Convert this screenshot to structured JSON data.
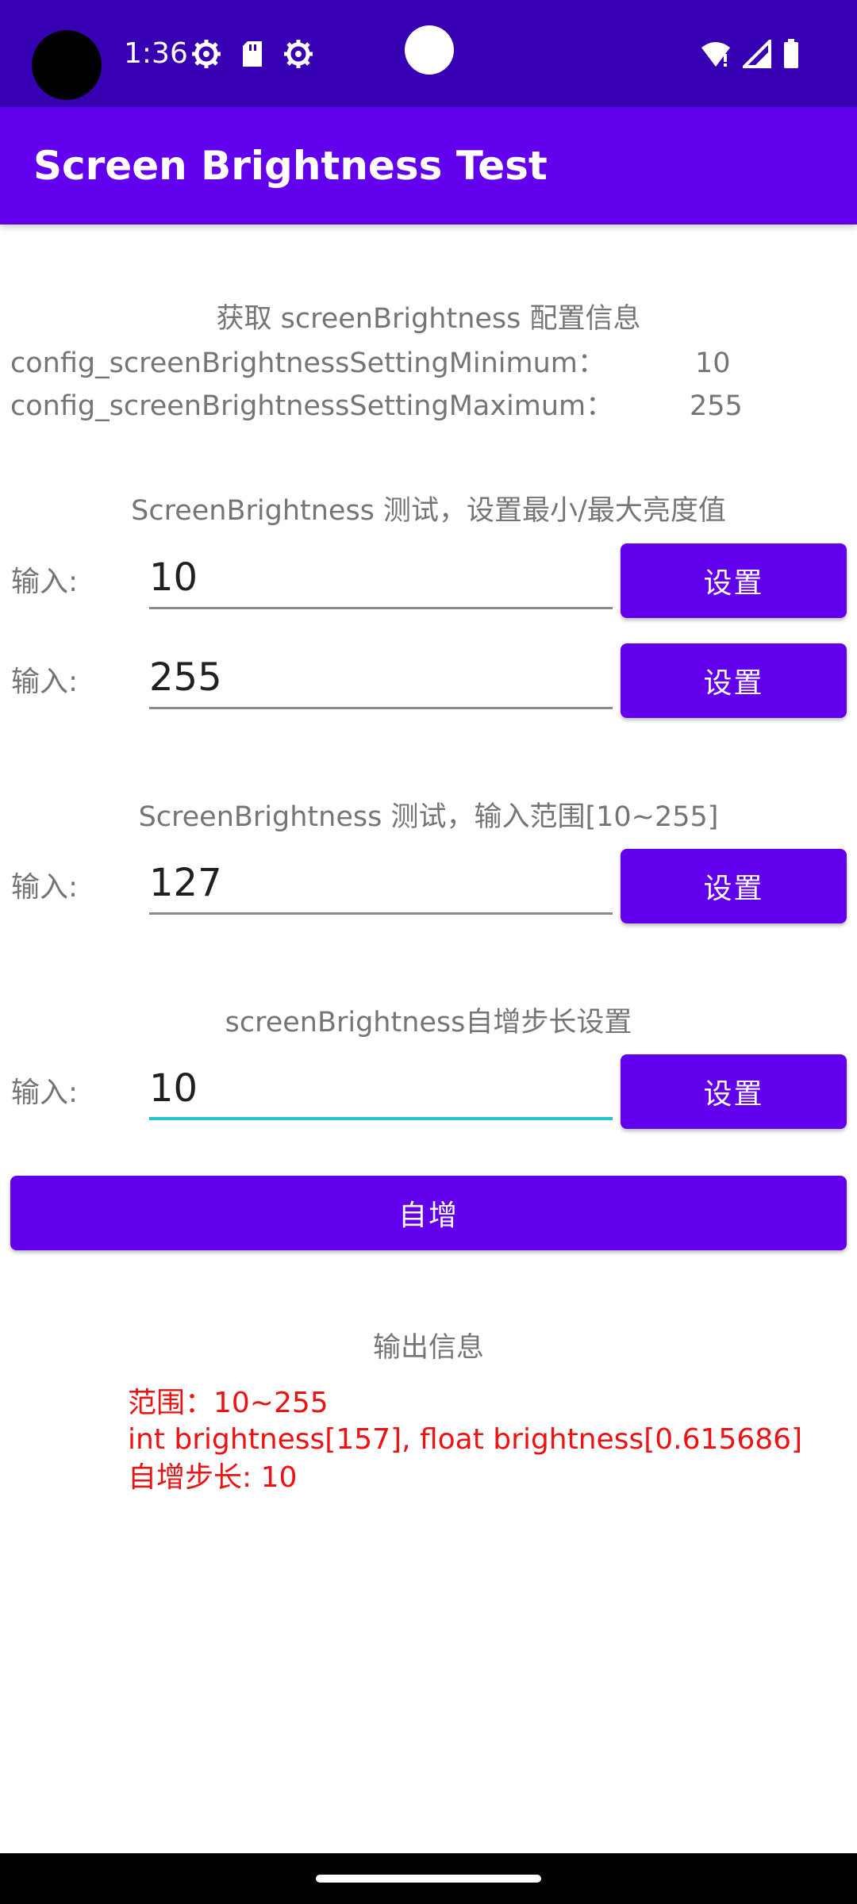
{
  "status_bar": {
    "time": "1:36",
    "icons_left": [
      "gear-icon",
      "sd-card-icon",
      "gear-icon"
    ],
    "icons_right": [
      "wifi-icon",
      "signal-icon",
      "battery-icon"
    ]
  },
  "app_bar": {
    "title": "Screen Brightness Test",
    "color": "#6200EE"
  },
  "config_section": {
    "heading": "获取 screenBrightness 配置信息",
    "min_label": "config_screenBrightnessSettingMinimum：",
    "min_value": "10",
    "max_label": "config_screenBrightnessSettingMaximum：",
    "max_value": "255"
  },
  "minmax_section": {
    "heading": "ScreenBrightness 测试，设置最小/最大亮度值",
    "row1": {
      "label": "输入:",
      "value": "10",
      "button": "设置"
    },
    "row2": {
      "label": "输入:",
      "value": "255",
      "button": "设置"
    }
  },
  "range_section": {
    "heading": "ScreenBrightness 测试，输入范围[10~255]",
    "row": {
      "label": "输入:",
      "value": "127",
      "button": "设置"
    }
  },
  "step_section": {
    "heading": "screenBrightness自增步长设置",
    "row": {
      "label": "输入:",
      "value": "10",
      "button": "设置"
    },
    "increment_button": "自增"
  },
  "output_section": {
    "heading": "输出信息",
    "lines": [
      "范围：10~255",
      "int brightness[157], float brightness[0.615686]",
      "自增步长: 10"
    ],
    "color": "#EE1111"
  }
}
